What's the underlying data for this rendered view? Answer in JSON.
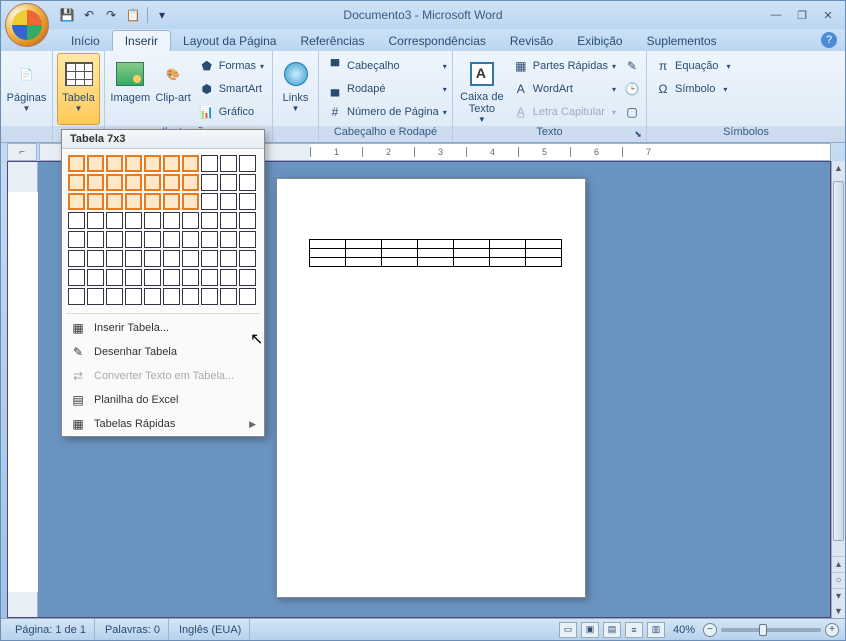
{
  "title": "Documento3 - Microsoft Word",
  "qat": {
    "save": "💾",
    "undo": "↶",
    "redo": "↷",
    "paste": "📋"
  },
  "tabs": {
    "home": "Início",
    "insert": "Inserir",
    "layout": "Layout da Página",
    "refs": "Referências",
    "mail": "Correspondências",
    "review": "Revisão",
    "view": "Exibição",
    "addins": "Suplementos"
  },
  "ribbon": {
    "pages": "Páginas",
    "table": "Tabela",
    "image": "Imagem",
    "clipart": "Clip-art",
    "shapes": "Formas",
    "smartart": "SmartArt",
    "chart": "Gráfico",
    "illus_group": "Ilustrações",
    "links": "Links",
    "header": "Cabeçalho",
    "footer": "Rodapé",
    "pagenum": "Número de Página",
    "hf_group": "Cabeçalho e Rodapé",
    "textbox": "Caixa de Texto",
    "quickparts": "Partes Rápidas",
    "wordart": "WordArt",
    "dropcap": "Letra Capitular",
    "text_group": "Texto",
    "equation": "Equação",
    "symbol": "Símbolo",
    "sym_group": "Símbolos"
  },
  "dropdown": {
    "title": "Tabela 7x3",
    "cols": 7,
    "rows": 3,
    "insert": "Inserir Tabela...",
    "draw": "Desenhar Tabela",
    "convert": "Converter Texto em Tabela...",
    "excel": "Planilha do Excel",
    "quick": "Tabelas Rápidas"
  },
  "status": {
    "page": "Página: 1 de 1",
    "words": "Palavras: 0",
    "lang": "Inglês (EUA)",
    "zoom": "40%"
  },
  "ruler_ticks": [
    "1",
    "2",
    "3",
    "4",
    "5",
    "6",
    "7"
  ]
}
